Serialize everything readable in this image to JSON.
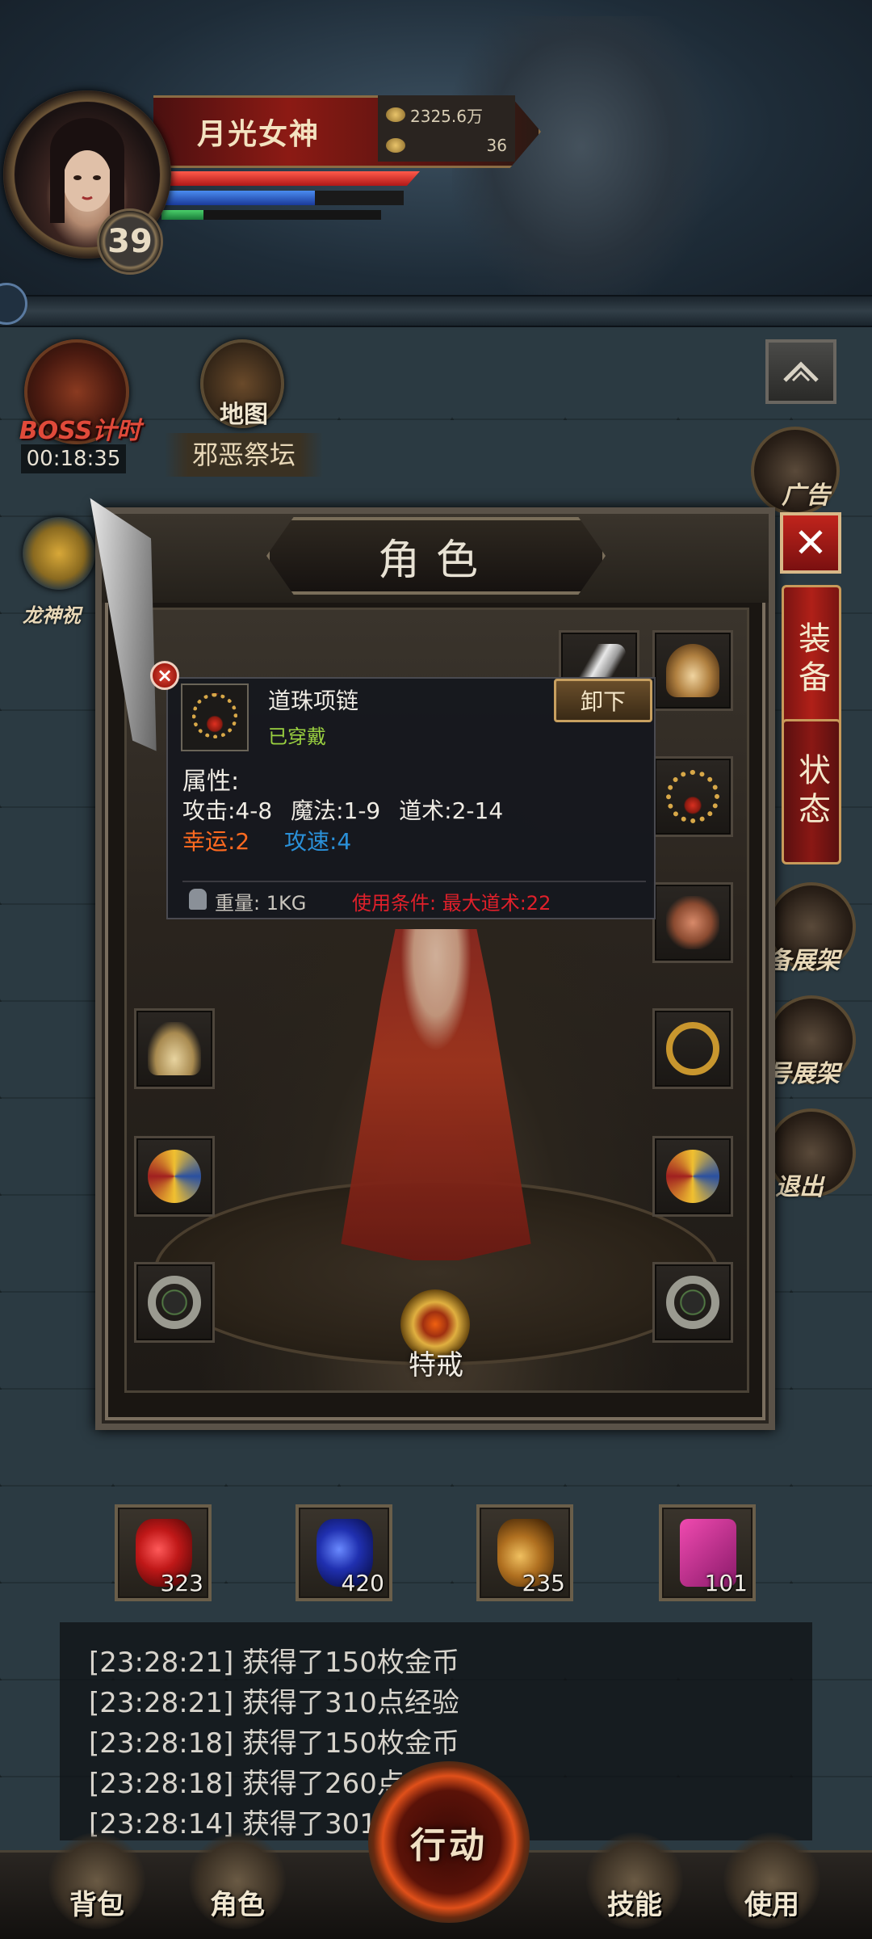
{
  "player": {
    "name": "月光女神",
    "level": "39",
    "gold": "2325.6万",
    "ingots": "36",
    "hp_fraction": 1.0,
    "mp_fraction": 0.63,
    "xp_fraction": 0.19
  },
  "quick": {
    "boss_label": "BOSS计时",
    "boss_timer": "00:18:35",
    "map_label": "地图",
    "area_name": "邪恶祭坛",
    "dragon_label": "龙神祝"
  },
  "right_side": {
    "collapse_icon": "chevron-up",
    "labels": [
      "广告",
      "备展架",
      "号展架",
      "退出"
    ]
  },
  "panel": {
    "title": "角色",
    "close": "✕",
    "tabs": [
      "装备",
      "状态"
    ],
    "special_slot": "特戒"
  },
  "tooltip": {
    "item_name": "道珠项链",
    "status": "已穿戴",
    "unequip_button": "卸下",
    "attr_title": "属性:",
    "attack": "攻击:4-8",
    "magic": "魔法:1-9",
    "tao": "道术:2-14",
    "luck": "幸运:2",
    "speed": "攻速:4",
    "weight": "重量:  1KG",
    "requirement": "使用条件:  最大道术:22"
  },
  "potions": [
    {
      "type": "red",
      "count": "323"
    },
    {
      "type": "blue",
      "count": "420"
    },
    {
      "type": "gold",
      "count": "235"
    },
    {
      "type": "pink",
      "count": "101"
    }
  ],
  "log": [
    "[23:28:21] 获得了150枚金币",
    "[23:28:21] 获得了310点经验",
    "[23:28:18] 获得了150枚金币",
    "[23:28:18] 获得了260点",
    "[23:28:14] 获得了301"
  ],
  "nav": {
    "bag": "背包",
    "role": "角色",
    "action": "行动",
    "skill": "技能",
    "use": "使用"
  }
}
